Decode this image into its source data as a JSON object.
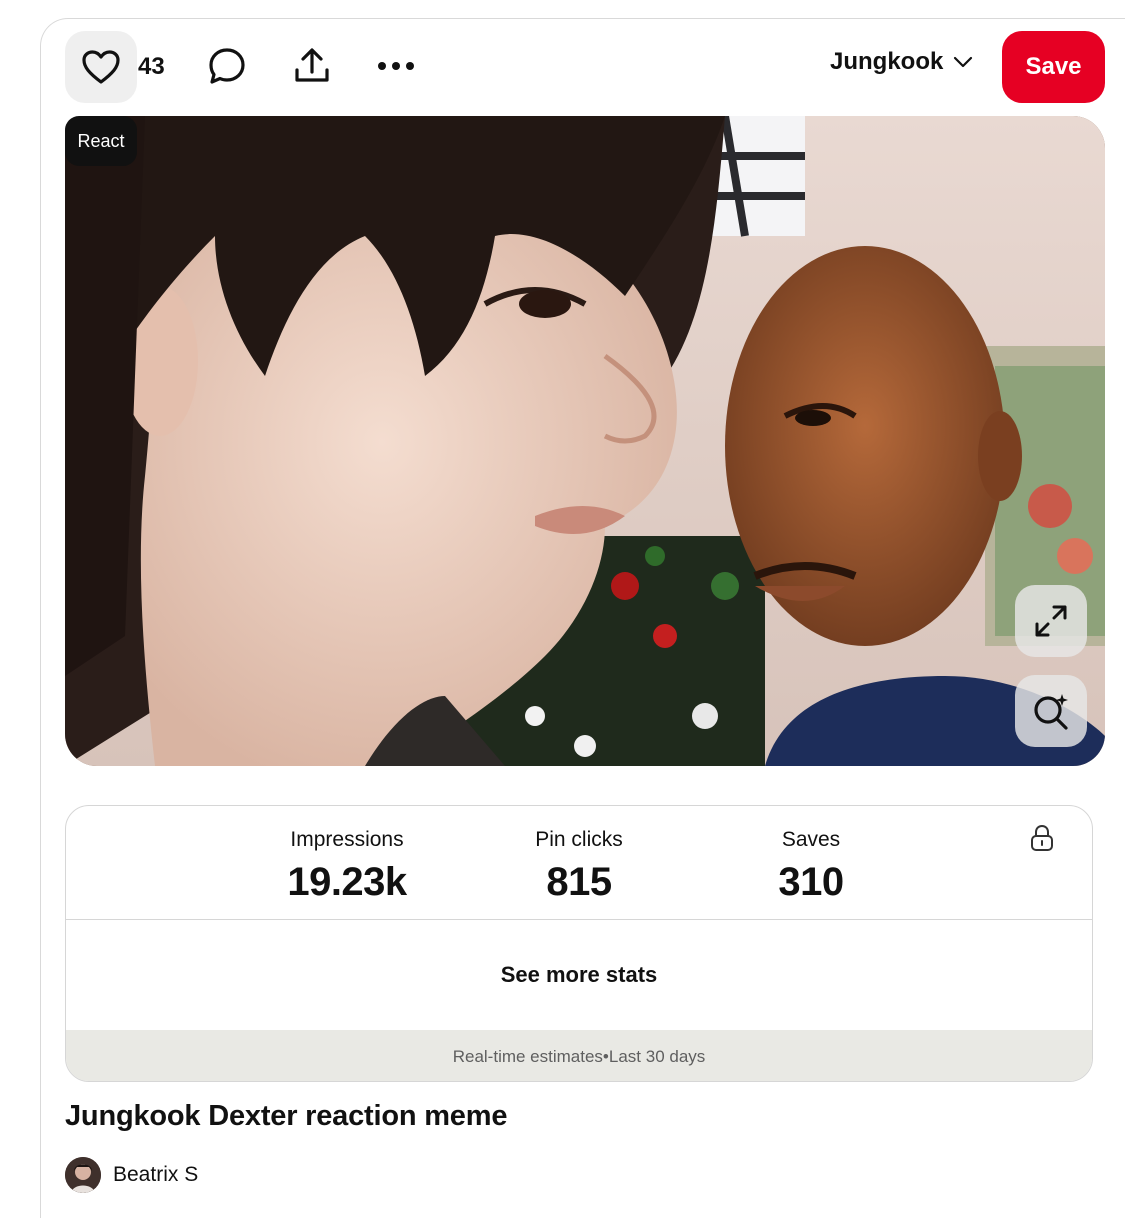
{
  "actions": {
    "reaction_count": "43",
    "board_name": "Jungkook",
    "save_label": "Save"
  },
  "pin": {
    "react_label": "React",
    "title": "Jungkook Dexter reaction meme"
  },
  "stats": {
    "items": [
      {
        "label": "Impressions",
        "value": "19.23k"
      },
      {
        "label": "Pin clicks",
        "value": "815"
      },
      {
        "label": "Saves",
        "value": "310"
      }
    ],
    "see_more_label": "See more stats",
    "estimates_text": "Real-time estimates•Last 30 days"
  },
  "author": {
    "name": "Beatrix S"
  },
  "colors": {
    "save_red": "#e60023"
  },
  "icons": [
    "heart-icon",
    "comment-icon",
    "share-icon",
    "more-icon",
    "chevron-down-icon",
    "expand-icon",
    "visual-search-icon",
    "lock-icon"
  ]
}
